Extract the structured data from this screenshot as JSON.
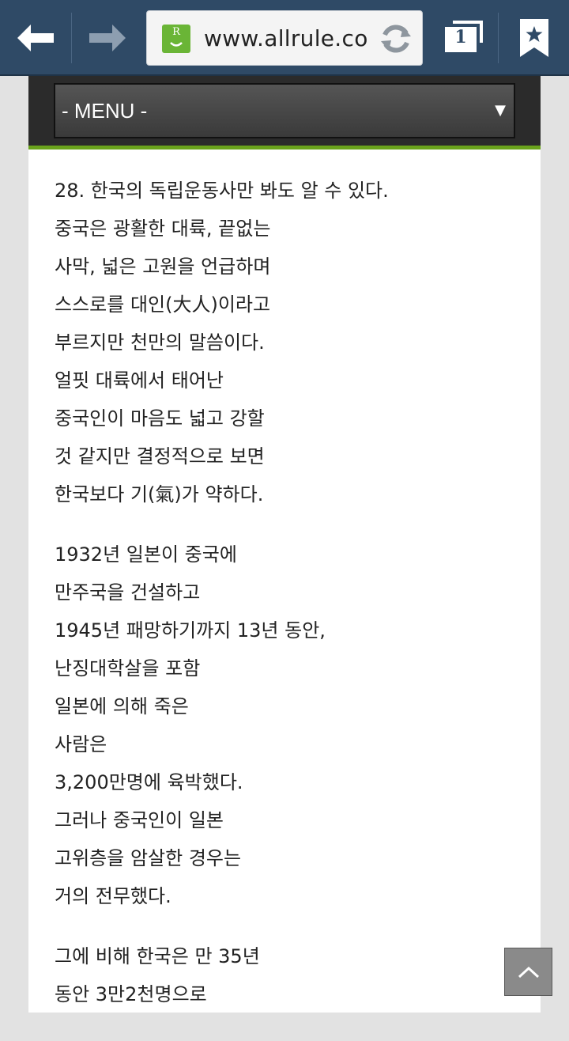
{
  "browser": {
    "url": "www.allrule.com",
    "site_badge_letter": "R",
    "tab_count": "1",
    "colors": {
      "toolbar": "#2f4a66",
      "badge": "#6ab536"
    }
  },
  "menu": {
    "label": "- MENU -",
    "arrow": "▼",
    "colors": {
      "accent": "#6aa31c",
      "band": "#2b2b2b"
    }
  },
  "content": {
    "paragraphs": [
      {
        "lines": [
          "28. 한국의 독립운동사만 봐도 알 수 있다.",
          "중국은 광활한 대륙, 끝없는",
          "사막, 넓은 고원을 언급하며",
          "스스로를 대인(大人)이라고",
          "부르지만 천만의 말씀이다.",
          "얼핏 대륙에서 태어난",
          "중국인이 마음도 넓고 강할",
          "것 같지만 결정적으로 보면",
          "한국보다 기(氣)가 약하다."
        ]
      },
      {
        "lines": [
          "1932년 일본이 중국에",
          "만주국을 건설하고",
          "1945년 패망하기까지 13년 동안,",
          "난징대학살을 포함",
          "일본에 의해 죽은",
          "사람은",
          "3,200만명에 육박했다.",
          "그러나 중국인이 일본",
          "고위층을 암살한 경우는",
          "거의 전무했다."
        ]
      },
      {
        "lines": [
          "그에 비해 한국은 만 35년",
          "동안 3만2천명으로"
        ]
      }
    ]
  }
}
